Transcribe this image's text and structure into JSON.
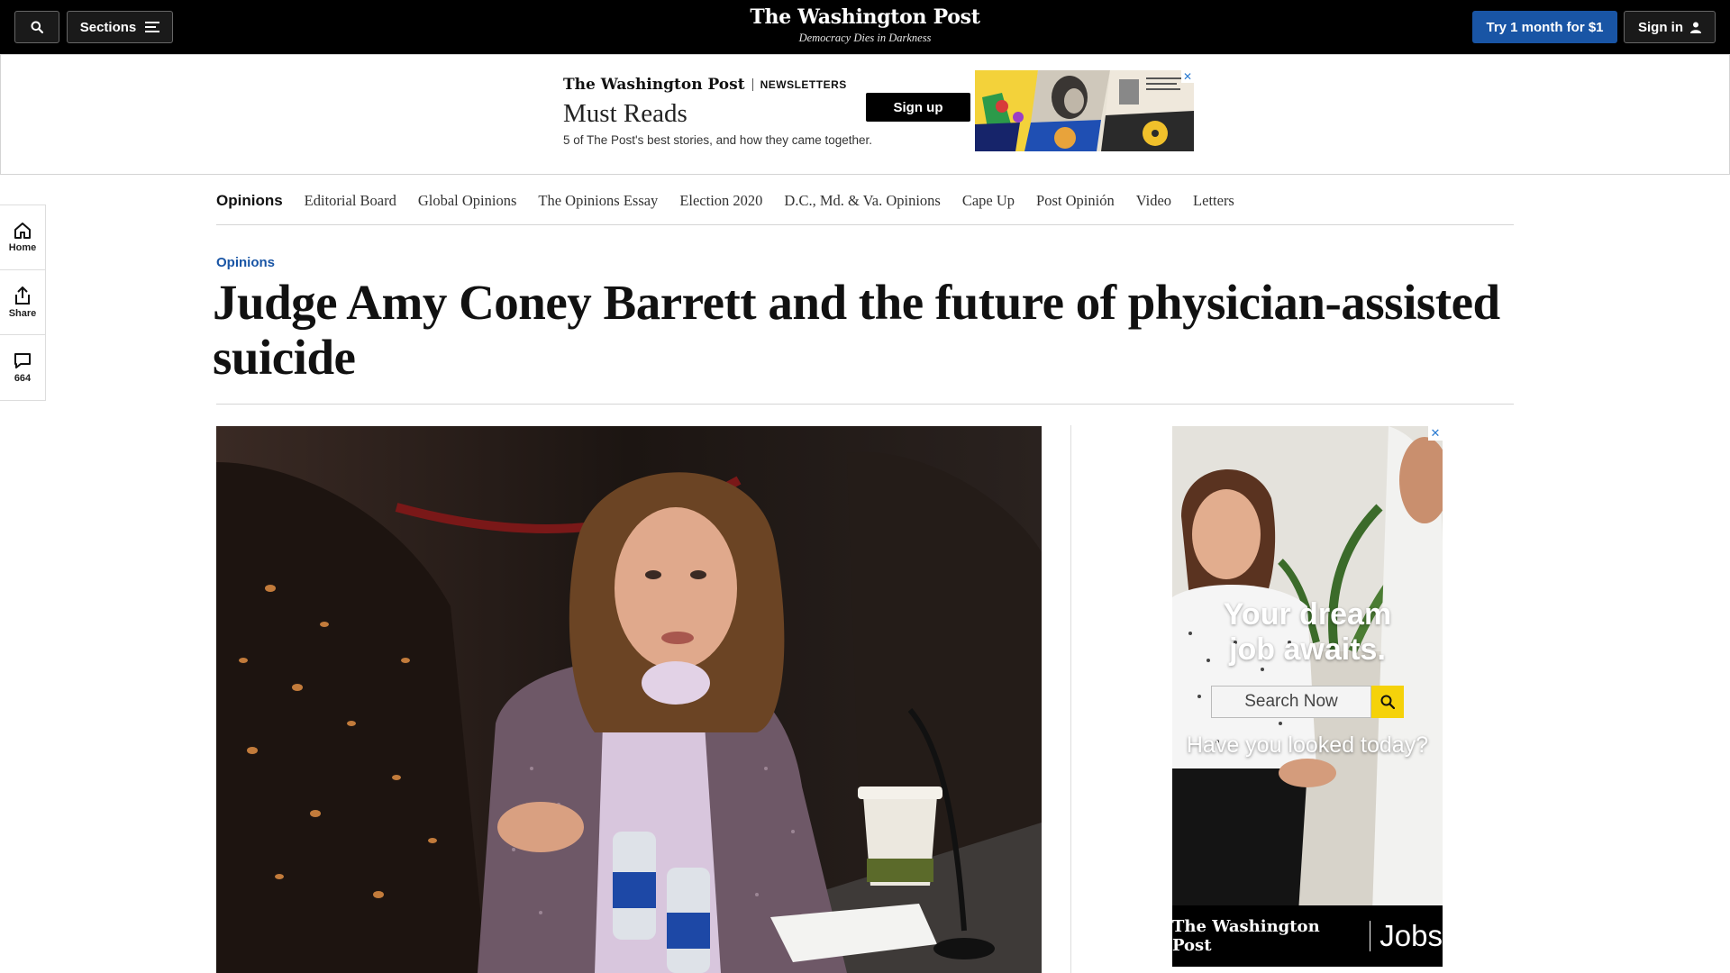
{
  "header": {
    "sections_label": "Sections",
    "logo": "The Washington Post",
    "tagline": "Democracy Dies in Darkness",
    "subscribe_label": "Try 1 month for $1",
    "signin_label": "Sign in"
  },
  "top_ad": {
    "brand": "The Washington Post",
    "newsletters": "NEWSLETTERS",
    "title": "Must Reads",
    "subtitle": "5 of The Post's best stories, and how they came together.",
    "signup_label": "Sign up",
    "close": "✕"
  },
  "rail": {
    "home_label": "Home",
    "share_label": "Share",
    "comments_count": "664"
  },
  "section_nav": {
    "items": [
      "Opinions",
      "Editorial Board",
      "Global Opinions",
      "The Opinions Essay",
      "Election 2020",
      "D.C., Md. & Va. Opinions",
      "Cape Up",
      "Post Opinión",
      "Video",
      "Letters"
    ]
  },
  "article": {
    "kicker": "Opinions",
    "headline": "Judge Amy Coney Barrett and the future of physician-assisted suicide"
  },
  "side_ad": {
    "headline_line1": "Your dream",
    "headline_line2": "job awaits.",
    "search_placeholder": "Search Now",
    "question": "Have you looked today?",
    "brand": "The Washington Post",
    "product": "Jobs",
    "close": "✕"
  },
  "colors": {
    "accent_blue": "#1955a5",
    "topbar_black": "#000000",
    "search_yellow": "#f5d20a"
  }
}
